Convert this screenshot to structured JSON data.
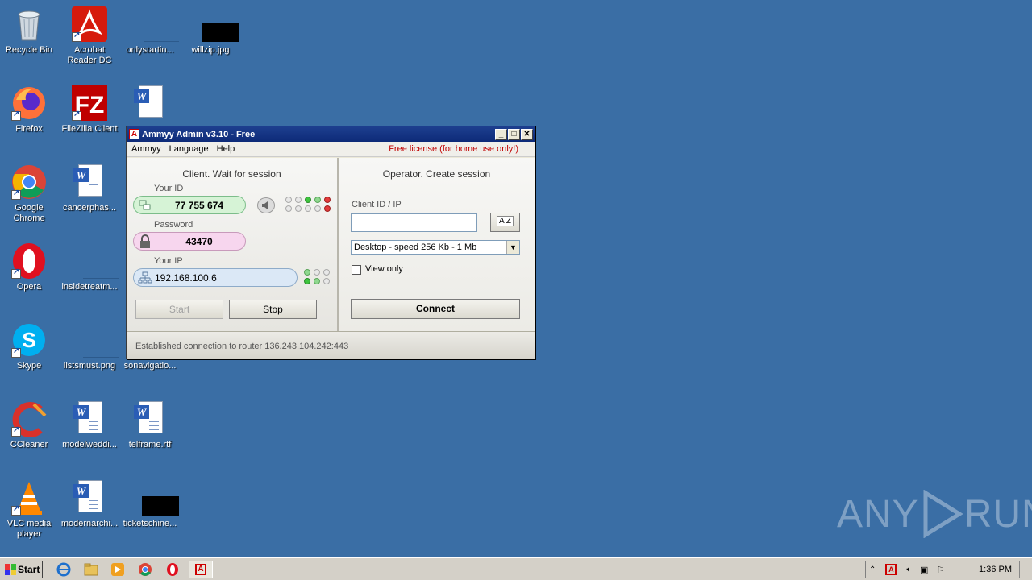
{
  "desktop": {
    "icons": [
      {
        "label": "Recycle Bin"
      },
      {
        "label": "Acrobat Reader DC"
      },
      {
        "label": "onlystartin..."
      },
      {
        "label": "willzip.jpg"
      },
      {
        "label": "Firefox"
      },
      {
        "label": "FileZilla Client"
      },
      {
        "label": "Google Chrome"
      },
      {
        "label": "cancerphas..."
      },
      {
        "label": "Opera"
      },
      {
        "label": "insidetreatm..."
      },
      {
        "label": "Skype"
      },
      {
        "label": "listsmust.png"
      },
      {
        "label": "sonavigatio..."
      },
      {
        "label": "CCleaner"
      },
      {
        "label": "modelweddi..."
      },
      {
        "label": "telframe.rtf"
      },
      {
        "label": "VLC media player"
      },
      {
        "label": "modernarchi..."
      },
      {
        "label": "ticketschine..."
      }
    ]
  },
  "window": {
    "title": "Ammyy Admin v3.10 - Free",
    "menu": [
      "Ammyy",
      "Language",
      "Help"
    ],
    "license": "Free license (for home use only!)",
    "client": {
      "title": "Client. Wait for session",
      "your_id_label": "Your ID",
      "your_id": "77 755 674",
      "password_label": "Password",
      "password": "43470",
      "your_ip_label": "Your IP",
      "your_ip": "192.168.100.6",
      "start_label": "Start",
      "stop_label": "Stop"
    },
    "operator": {
      "title": "Operator. Create session",
      "client_id_label": "Client ID / IP",
      "client_id_value": "",
      "az_label": "A Z",
      "speed_value": "Desktop - speed  256 Kb - 1 Mb",
      "view_only_label": "View only",
      "connect_label": "Connect"
    },
    "status": "Established connection to router 136.243.104.242:443"
  },
  "taskbar": {
    "start_label": "Start",
    "clock": "1:36 PM"
  },
  "watermark": {
    "text_left": "ANY",
    "text_right": "RUN"
  },
  "colors": {
    "desktop": "#3a6ea5",
    "license": "#c00000",
    "title_bar": "#0d2a78"
  }
}
